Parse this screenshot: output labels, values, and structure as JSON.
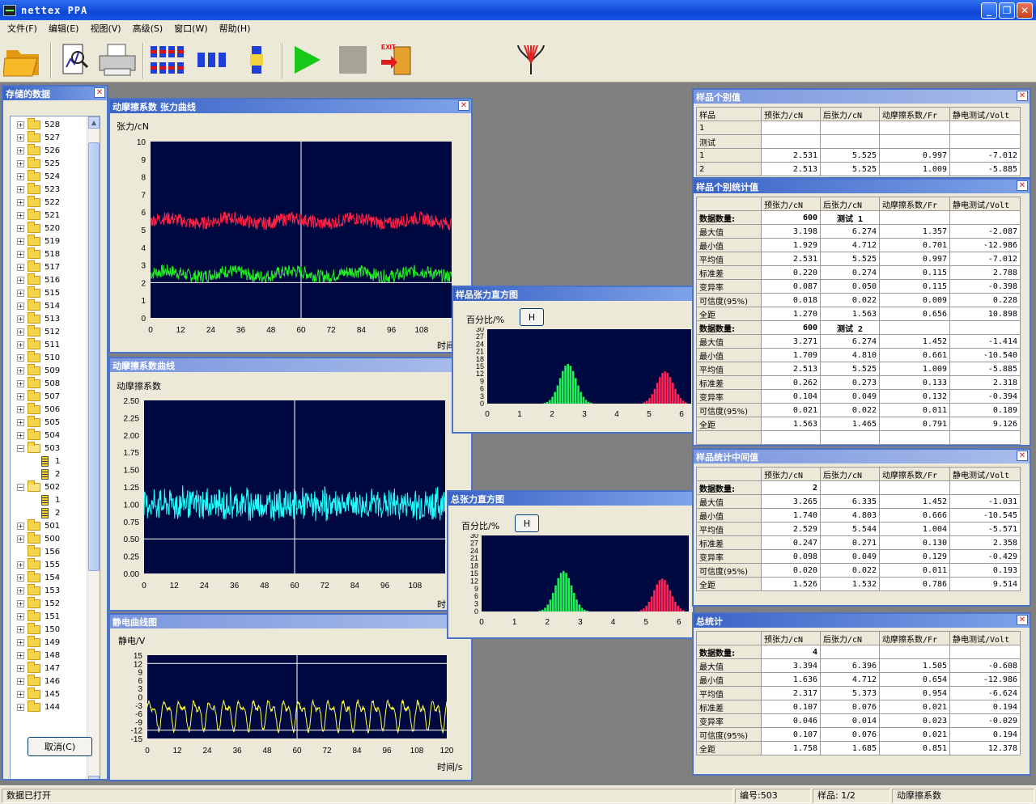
{
  "app": {
    "title": "nettex  PPA"
  },
  "menu": [
    "文件(F)",
    "编辑(E)",
    "视图(V)",
    "高级(S)",
    "窗口(W)",
    "帮助(H)"
  ],
  "tree_panel": {
    "title": "存储的数据",
    "cancel_label": "取消(C)",
    "items": [
      {
        "label": "528",
        "type": "folder"
      },
      {
        "label": "527",
        "type": "folder"
      },
      {
        "label": "526",
        "type": "folder"
      },
      {
        "label": "525",
        "type": "folder"
      },
      {
        "label": "524",
        "type": "folder"
      },
      {
        "label": "523",
        "type": "folder"
      },
      {
        "label": "522",
        "type": "folder"
      },
      {
        "label": "521",
        "type": "folder"
      },
      {
        "label": "520",
        "type": "folder"
      },
      {
        "label": "519",
        "type": "folder"
      },
      {
        "label": "518",
        "type": "folder"
      },
      {
        "label": "517",
        "type": "folder"
      },
      {
        "label": "516",
        "type": "folder"
      },
      {
        "label": "515",
        "type": "folder"
      },
      {
        "label": "514",
        "type": "folder"
      },
      {
        "label": "513",
        "type": "folder"
      },
      {
        "label": "512",
        "type": "folder"
      },
      {
        "label": "511",
        "type": "folder"
      },
      {
        "label": "510",
        "type": "folder"
      },
      {
        "label": "509",
        "type": "folder"
      },
      {
        "label": "508",
        "type": "folder"
      },
      {
        "label": "507",
        "type": "folder"
      },
      {
        "label": "506",
        "type": "folder"
      },
      {
        "label": "505",
        "type": "folder"
      },
      {
        "label": "504",
        "type": "folder"
      },
      {
        "label": "503",
        "type": "open"
      },
      {
        "label": "1",
        "type": "spool"
      },
      {
        "label": "2",
        "type": "spool"
      },
      {
        "label": "502",
        "type": "open"
      },
      {
        "label": "1",
        "type": "spool"
      },
      {
        "label": "2",
        "type": "spool"
      },
      {
        "label": "501",
        "type": "folder"
      },
      {
        "label": "500",
        "type": "folder"
      },
      {
        "label": "156",
        "type": "leaf"
      },
      {
        "label": "155",
        "type": "folder"
      },
      {
        "label": "154",
        "type": "folder"
      },
      {
        "label": "153",
        "type": "folder"
      },
      {
        "label": "152",
        "type": "folder"
      },
      {
        "label": "151",
        "type": "folder"
      },
      {
        "label": "150",
        "type": "folder"
      },
      {
        "label": "149",
        "type": "folder"
      },
      {
        "label": "148",
        "type": "folder"
      },
      {
        "label": "147",
        "type": "folder"
      },
      {
        "label": "146",
        "type": "folder"
      },
      {
        "label": "145",
        "type": "folder"
      },
      {
        "label": "144",
        "type": "folder"
      }
    ]
  },
  "tension_panel": {
    "title": "动摩擦系数 张力曲线",
    "ylabel": "张力/cN",
    "xlabel": "时间"
  },
  "friction_panel": {
    "title": "动摩擦系数曲线",
    "ylabel": "动摩擦系数",
    "xlabel": "时"
  },
  "static_panel": {
    "title": "静电曲线图",
    "ylabel": "静电/V",
    "xlabel": "时间/s"
  },
  "hist1": {
    "title": "样品张力直方图",
    "ylabel": "百分比/%",
    "button": "H"
  },
  "hist2": {
    "title": "总张力直方图",
    "ylabel": "百分比/%",
    "button": "H"
  },
  "chart_data": [
    {
      "type": "line",
      "name": "tension",
      "ylim": [
        0,
        10
      ],
      "yticks": [
        "0",
        "1",
        "2",
        "3",
        "4",
        "5",
        "6",
        "7",
        "8",
        "9",
        "10"
      ],
      "xticks": [
        "0",
        "12",
        "24",
        "36",
        "48",
        "60",
        "72",
        "84",
        "96",
        "108"
      ],
      "series": [
        {
          "name": "pre-tension",
          "mean": 2.5,
          "color": "#22ee22"
        },
        {
          "name": "post-tension",
          "mean": 5.5,
          "color": "#ff2244"
        }
      ]
    },
    {
      "type": "line",
      "name": "friction",
      "ylim": [
        0,
        2.5
      ],
      "yticks": [
        "0.00",
        "0.25",
        "0.50",
        "0.75",
        "1.00",
        "1.25",
        "1.50",
        "1.75",
        "2.00",
        "2.25",
        "2.50"
      ],
      "xticks": [
        "0",
        "12",
        "24",
        "36",
        "48",
        "60",
        "72",
        "84",
        "96",
        "108"
      ],
      "series": [
        {
          "name": "friction",
          "mean": 1.0,
          "color": "#22ffff"
        }
      ]
    },
    {
      "type": "line",
      "name": "static",
      "ylim": [
        -15,
        15
      ],
      "yticks": [
        "-15",
        "-12",
        "-9",
        "-6",
        "-3",
        "0",
        "3",
        "6",
        "9",
        "12",
        "15"
      ],
      "xticks": [
        "0",
        "12",
        "24",
        "36",
        "48",
        "60",
        "72",
        "84",
        "96",
        "108",
        "120"
      ],
      "series": [
        {
          "name": "static",
          "mean": -6,
          "color": "#ffff44"
        }
      ]
    },
    {
      "type": "bar",
      "name": "hist-sample",
      "ylim": [
        0,
        30
      ],
      "yticks": [
        "0",
        "3",
        "6",
        "9",
        "12",
        "15",
        "18",
        "21",
        "24",
        "27",
        "30"
      ],
      "xticks": [
        "0",
        "1",
        "2",
        "3",
        "4",
        "5",
        "6"
      ],
      "series": [
        {
          "name": "pre",
          "center": 2.5,
          "peak": 16,
          "color": "#22ee55"
        },
        {
          "name": "post",
          "center": 5.5,
          "peak": 13,
          "color": "#ff2255"
        }
      ]
    },
    {
      "type": "bar",
      "name": "hist-total",
      "ylim": [
        0,
        30
      ],
      "yticks": [
        "0",
        "3",
        "6",
        "9",
        "12",
        "15",
        "18",
        "21",
        "24",
        "27",
        "30"
      ],
      "xticks": [
        "0",
        "1",
        "2",
        "3",
        "4",
        "5",
        "6"
      ],
      "series": [
        {
          "name": "pre",
          "center": 2.5,
          "peak": 16,
          "color": "#22ee55"
        },
        {
          "name": "post",
          "center": 5.5,
          "peak": 13,
          "color": "#ff2255"
        }
      ]
    }
  ],
  "t1": {
    "title": "样品个别值",
    "headers": [
      "样品",
      "预张力/cN",
      "后张力/cN",
      "动摩擦系数/Fr",
      "静电测试/Volt"
    ],
    "rows": [
      [
        "1",
        "",
        "",
        "",
        ""
      ],
      [
        "测试",
        "",
        "",
        "",
        ""
      ],
      [
        "1",
        "2.531",
        "5.525",
        "0.997",
        "-7.012"
      ],
      [
        "2",
        "2.513",
        "5.525",
        "1.009",
        "-5.885"
      ]
    ]
  },
  "t2": {
    "title": "样品个别统计值",
    "headers": [
      "",
      "预张力/cN",
      "后张力/cN",
      "动摩擦系数/Fr",
      "静电测试/Volt"
    ],
    "rows": [
      [
        "数据数量:",
        "600",
        "测试  1",
        "",
        ""
      ],
      [
        "最大值",
        "3.198",
        "6.274",
        "1.357",
        "-2.087"
      ],
      [
        "最小值",
        "1.929",
        "4.712",
        "0.701",
        "-12.986"
      ],
      [
        "平均值",
        "2.531",
        "5.525",
        "0.997",
        "-7.012"
      ],
      [
        "标准差",
        "0.220",
        "0.274",
        "0.115",
        "2.788"
      ],
      [
        "变异率",
        "0.087",
        "0.050",
        "0.115",
        "-0.398"
      ],
      [
        "可信度(95%)",
        "0.018",
        "0.022",
        "0.009",
        "0.228"
      ],
      [
        "全距",
        "1.270",
        "1.563",
        "0.656",
        "10.898"
      ],
      [
        "数据数量:",
        "600",
        "测试  2",
        "",
        ""
      ],
      [
        "最大值",
        "3.271",
        "6.274",
        "1.452",
        "-1.414"
      ],
      [
        "最小值",
        "1.709",
        "4.810",
        "0.661",
        "-10.540"
      ],
      [
        "平均值",
        "2.513",
        "5.525",
        "1.009",
        "-5.885"
      ],
      [
        "标准差",
        "0.262",
        "0.273",
        "0.133",
        "2.318"
      ],
      [
        "变异率",
        "0.104",
        "0.049",
        "0.132",
        "-0.394"
      ],
      [
        "可信度(95%)",
        "0.021",
        "0.022",
        "0.011",
        "0.189"
      ],
      [
        "全距",
        "1.563",
        "1.465",
        "0.791",
        "9.126"
      ],
      [
        "",
        "",
        "",
        "",
        ""
      ]
    ]
  },
  "t3": {
    "title": "样品统计中间值",
    "headers": [
      "",
      "预张力/cN",
      "后张力/cN",
      "动摩擦系数/Fr",
      "静电测试/Volt"
    ],
    "rows": [
      [
        "数据数量:",
        "2",
        "",
        "",
        ""
      ],
      [
        "最大值",
        "3.265",
        "6.335",
        "1.452",
        "-1.031"
      ],
      [
        "最小值",
        "1.740",
        "4.803",
        "0.666",
        "-10.545"
      ],
      [
        "平均值",
        "2.529",
        "5.544",
        "1.004",
        "-5.571"
      ],
      [
        "标准差",
        "0.247",
        "0.271",
        "0.130",
        "2.358"
      ],
      [
        "变异率",
        "0.098",
        "0.049",
        "0.129",
        "-0.429"
      ],
      [
        "可信度(95%)",
        "0.020",
        "0.022",
        "0.011",
        "0.193"
      ],
      [
        "全距",
        "1.526",
        "1.532",
        "0.786",
        "9.514"
      ]
    ]
  },
  "t4": {
    "title": "总统计",
    "headers": [
      "",
      "预张力/cN",
      "后张力/cN",
      "动摩擦系数/Fr",
      "静电测试/Volt"
    ],
    "rows": [
      [
        "数据数量:",
        "4",
        "",
        "",
        ""
      ],
      [
        "最大值",
        "3.394",
        "6.396",
        "1.505",
        "-0.608"
      ],
      [
        "最小值",
        "1.636",
        "4.712",
        "0.654",
        "-12.986"
      ],
      [
        "平均值",
        "2.317",
        "5.373",
        "0.954",
        "-6.624"
      ],
      [
        "标准差",
        "0.107",
        "0.076",
        "0.021",
        "0.194"
      ],
      [
        "变异率",
        "0.046",
        "0.014",
        "0.023",
        "-0.029"
      ],
      [
        "可信度(95%)",
        "0.107",
        "0.076",
        "0.021",
        "0.194"
      ],
      [
        "全距",
        "1.758",
        "1.685",
        "0.851",
        "12.378"
      ]
    ]
  },
  "status": {
    "message": "数据已打开",
    "number": "编号:503",
    "sample": "样品: 1/2",
    "mode": "动摩擦系数"
  },
  "icons": [
    "open-folder-icon",
    "report-preview-icon",
    "printer-icon",
    "multi-spool-icon",
    "triple-spool-icon",
    "single-spool-icon",
    "start-icon",
    "stop-icon",
    "exit-icon",
    "yarn-icon"
  ],
  "exit_text": "EXIT"
}
